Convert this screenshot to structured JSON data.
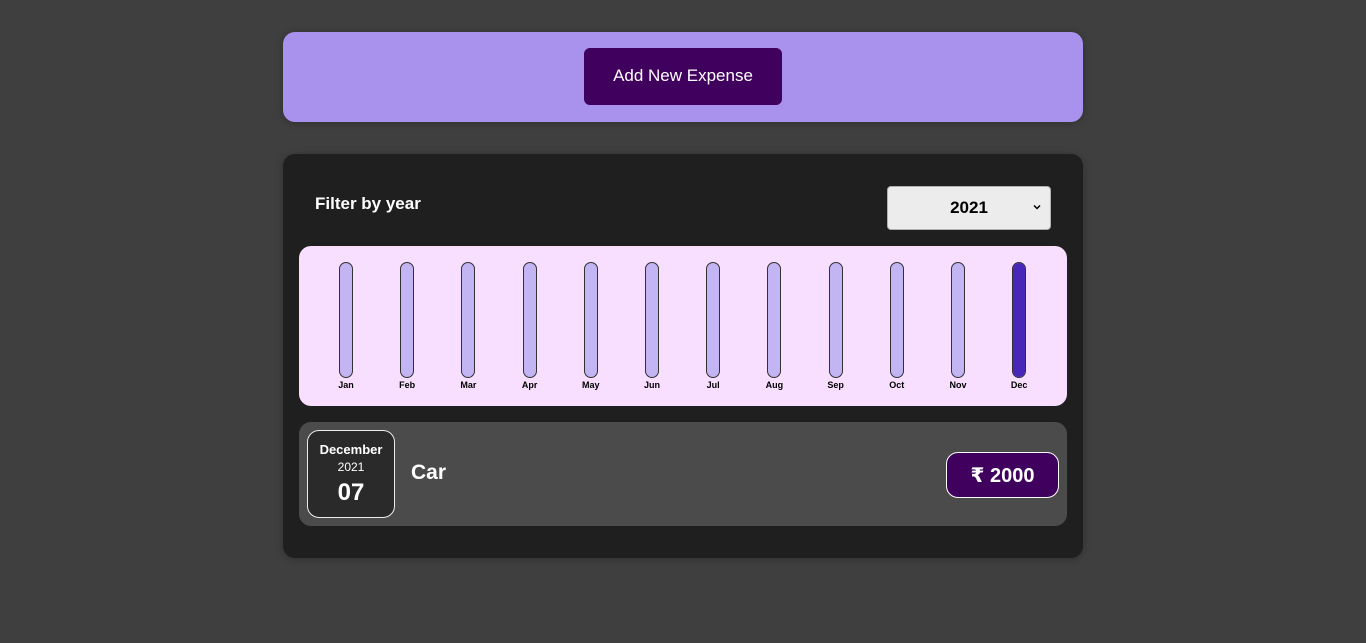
{
  "new_expense": {
    "add_button_label": "Add New Expense"
  },
  "filter": {
    "label": "Filter by year",
    "selected_year": "2021"
  },
  "chart_data": {
    "type": "bar",
    "categories": [
      "Jan",
      "Feb",
      "Mar",
      "Apr",
      "May",
      "Jun",
      "Jul",
      "Aug",
      "Sep",
      "Oct",
      "Nov",
      "Dec"
    ],
    "values": [
      0,
      0,
      0,
      0,
      0,
      0,
      0,
      0,
      0,
      0,
      0,
      2000
    ],
    "ylim": [
      0,
      2000
    ],
    "colors": {
      "bar_empty": "#c3b4f3",
      "bar_fill": "#4826b9"
    }
  },
  "expenses": [
    {
      "month": "December",
      "year": "2021",
      "day": "07",
      "title": "Car",
      "amount": "₹ 2000"
    }
  ],
  "colors": {
    "page_bg": "#3f3f3f",
    "new_expense_bg": "#a892ee",
    "button_bg": "#40005d",
    "panel_bg": "#1f1f1f",
    "chart_bg": "#f8dfff",
    "item_bg": "#4b4b4b"
  }
}
